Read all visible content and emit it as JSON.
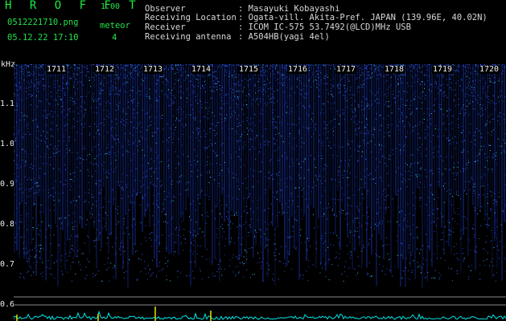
{
  "app": {
    "name": "H R O F F T",
    "version": "1.00"
  },
  "capture": {
    "file": "0512221710.png",
    "datetime": "05.12.22 17:10",
    "meteor_label": "meteor",
    "meteor_count": "4"
  },
  "info": [
    {
      "key": "Observer",
      "value": ": Masayuki Kobayashi"
    },
    {
      "key": "Receiving Location",
      "value": ": Ogata-vill. Akita-Pref. JAPAN (139.96E, 40.02N)"
    },
    {
      "key": "Receiver",
      "value": ": ICOM IC-575 53.7492(@LCD)MHz USB"
    },
    {
      "key": "Receiving antenna",
      "value": ": A504HB(yagi 4el)"
    }
  ],
  "axis": {
    "unit": "kHz",
    "freq_ticks": [
      "1.1",
      "1.0",
      "0.9",
      "0.8",
      "0.7",
      "0.6"
    ],
    "time_ticks": [
      "1711",
      "1712",
      "1713",
      "1714",
      "1715",
      "1716",
      "1717",
      "1718",
      "1719",
      "1720"
    ]
  },
  "colors": {
    "header_text": "#22e14a",
    "spectrum": "#2a4fd8",
    "baseline": "#00e5e5",
    "meteor_trace": "#e6e600"
  }
}
